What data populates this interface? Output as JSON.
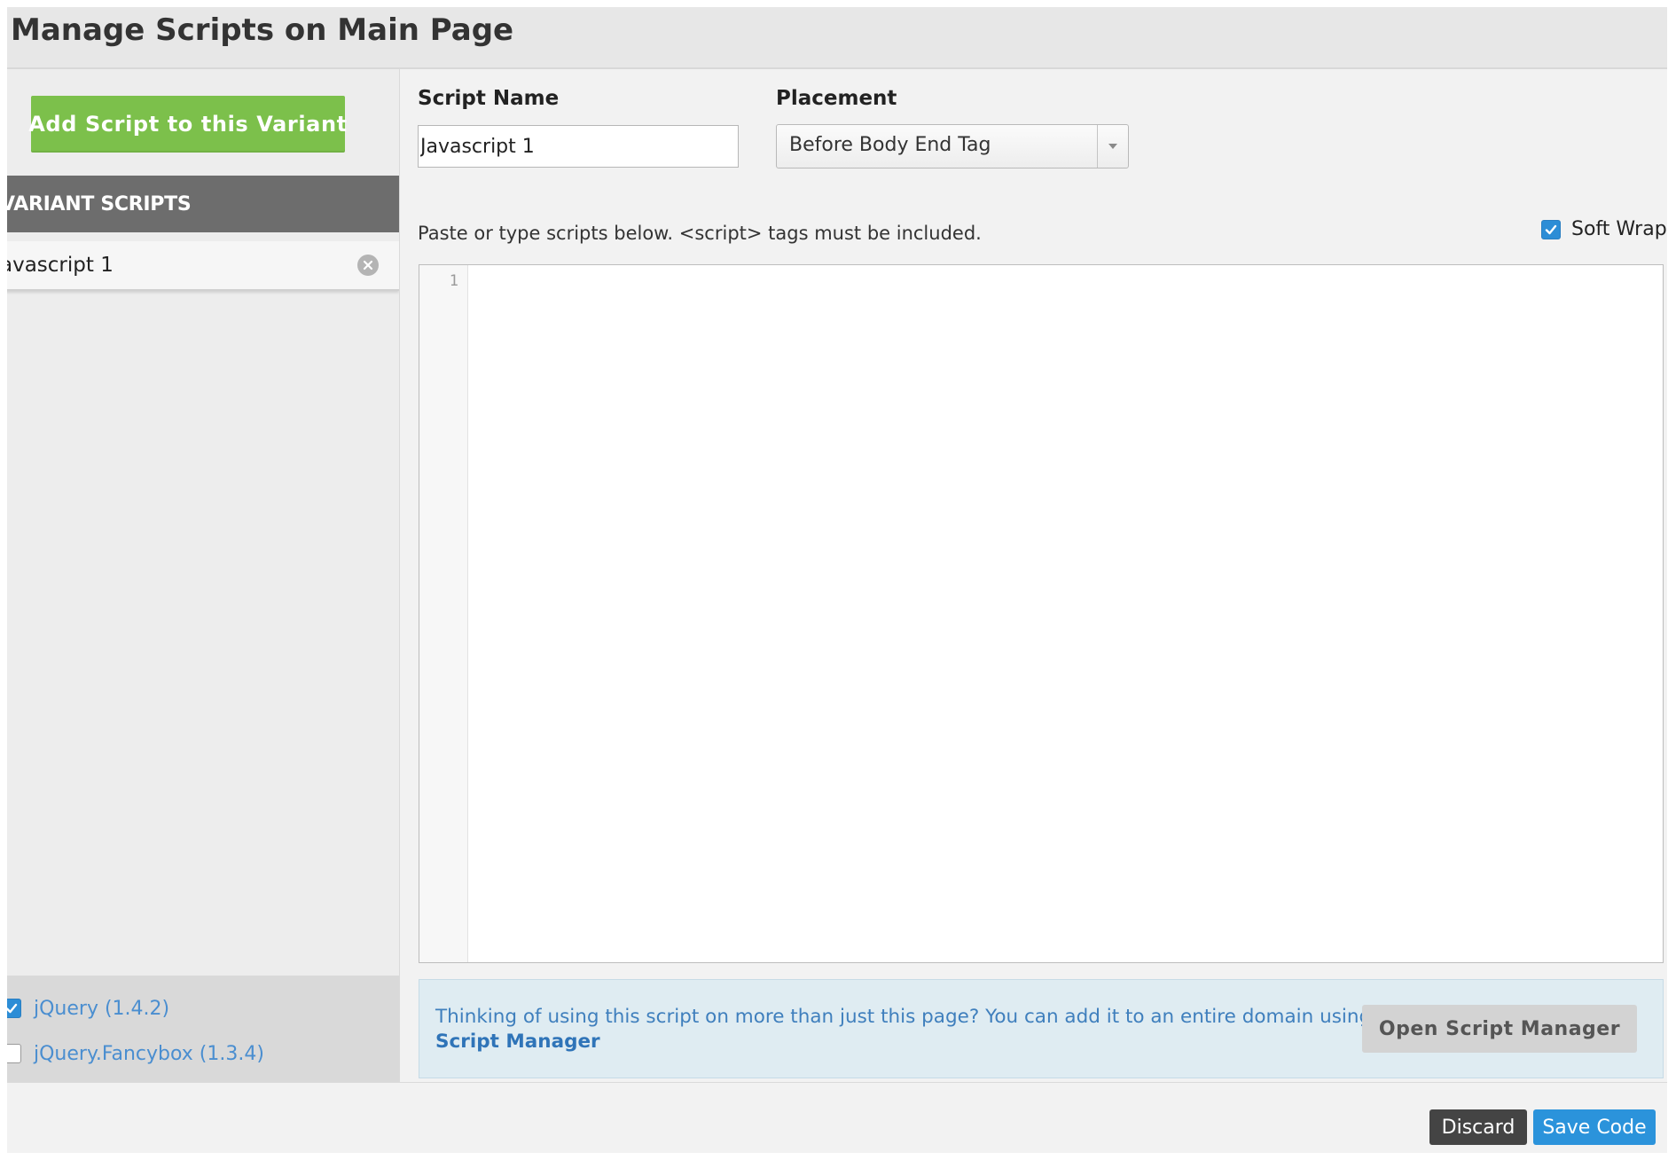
{
  "dialog": {
    "title": "Manage Scripts on Main Page"
  },
  "sidebar": {
    "add_button_label": "Add Script to this Variant",
    "section_header": "VARIANT SCRIPTS",
    "scripts": [
      {
        "label": "avascript 1"
      }
    ],
    "libraries": [
      {
        "label": "jQuery (1.4.2)",
        "checked": true
      },
      {
        "label": "jQuery.Fancybox (1.3.4)",
        "checked": false
      }
    ]
  },
  "form": {
    "script_name_label": "Script Name",
    "script_name_value": "Javascript 1",
    "placement_label": "Placement",
    "placement_value": "Before Body End Tag",
    "hint": "Paste or type scripts below. <script> tags must be included.",
    "soft_wrap_label": "Soft Wrap",
    "soft_wrap_checked": true
  },
  "editor": {
    "line_numbers": [
      "1"
    ]
  },
  "info": {
    "text": "Thinking of using this script on more than just this page? You can add it to an entire domain using",
    "link_text": "Script Manager",
    "button_label": "Open Script Manager"
  },
  "footer": {
    "discard_label": "Discard",
    "save_label": "Save Code"
  },
  "colors": {
    "add_button": "#7cc04b",
    "section_header": "#6d6d6d",
    "link_blue": "#3f7fbd",
    "save_button": "#2b93db",
    "discard_button": "#444444",
    "info_background": "#dfecf2"
  },
  "icons": {
    "remove": "remove-circle-x-icon",
    "dropdown": "triangle-down-icon",
    "checkbox": "checkmark-icon"
  }
}
